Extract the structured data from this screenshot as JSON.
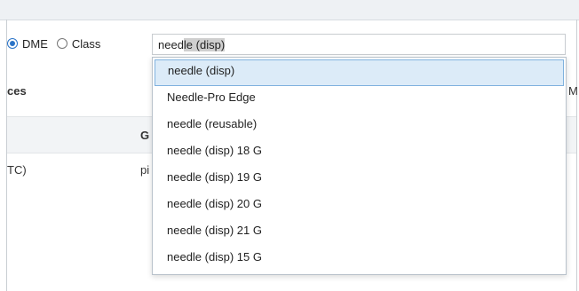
{
  "filter": {
    "options": [
      {
        "label": "DME",
        "checked": true
      },
      {
        "label": "Class",
        "checked": false
      }
    ]
  },
  "search": {
    "typed": "need",
    "completion": "le (disp)"
  },
  "table": {
    "header_left": "ces",
    "header_right": "M",
    "group_label": "G",
    "row_left": "TC)",
    "row_mid": "pi"
  },
  "dropdown": {
    "items": [
      "needle (disp)",
      "Needle-Pro Edge",
      "needle (reusable)",
      "needle (disp) 18 G",
      "needle (disp) 19 G",
      "needle (disp) 20 G",
      "needle (disp) 21 G",
      "needle (disp) 15 G"
    ],
    "active_index": 0
  },
  "colors": {
    "accent": "#2a73c7",
    "highlight": "#dcebf8"
  }
}
